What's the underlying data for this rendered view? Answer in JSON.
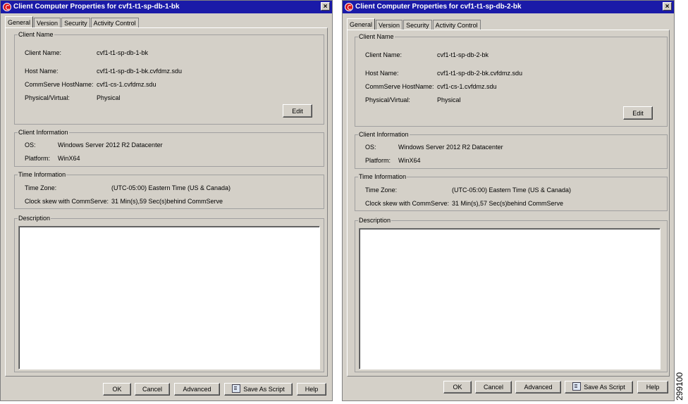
{
  "dialogs": [
    {
      "title": "Client Computer Properties for cvf1-t1-sp-db-1-bk",
      "close_label": "×",
      "tabs": [
        "General",
        "Version",
        "Security",
        "Activity Control"
      ],
      "client_name_group": {
        "legend": "Client Name",
        "client_name_label": "Client Name:",
        "client_name": "cvf1-t1-sp-db-1-bk",
        "host_name_label": "Host Name:",
        "host_name": "cvf1-t1-sp-db-1-bk.cvfdmz.sdu",
        "commserve_label": "CommServe HostName:",
        "commserve": "cvf1-cs-1.cvfdmz.sdu",
        "physvirt_label": "Physical/Virtual:",
        "physvirt": "Physical",
        "edit_label": "Edit"
      },
      "client_info_group": {
        "legend": "Client Information",
        "os_label": "OS:",
        "os": "Windows Server 2012 R2 Datacenter",
        "platform_label": "Platform:",
        "platform": "WinX64"
      },
      "time_group": {
        "legend": "Time Information",
        "tz_label": "Time Zone:",
        "tz": "(UTC-05:00) Eastern Time (US & Canada)",
        "skew_label": "Clock skew with CommServe:",
        "skew": "31 Min(s),59 Sec(s)behind CommServe"
      },
      "description_group": {
        "legend": "Description",
        "value": ""
      },
      "buttons": {
        "ok": "OK",
        "cancel": "Cancel",
        "advanced": "Advanced",
        "save_script": "Save As Script",
        "help": "Help"
      }
    },
    {
      "title": "Client Computer Properties for cvf1-t1-sp-db-2-bk",
      "close_label": "×",
      "tabs": [
        "General",
        "Version",
        "Security",
        "Activity Control"
      ],
      "client_name_group": {
        "legend": "Client Name",
        "client_name_label": "Client Name:",
        "client_name": "cvf1-t1-sp-db-2-bk",
        "host_name_label": "Host Name:",
        "host_name": "cvf1-t1-sp-db-2-bk.cvfdmz.sdu",
        "commserve_label": "CommServe HostName:",
        "commserve": "cvf1-cs-1.cvfdmz.sdu",
        "physvirt_label": "Physical/Virtual:",
        "physvirt": "Physical",
        "edit_label": "Edit"
      },
      "client_info_group": {
        "legend": "Client Information",
        "os_label": "OS:",
        "os": "Windows Server 2012 R2 Datacenter",
        "platform_label": "Platform:",
        "platform": "WinX64"
      },
      "time_group": {
        "legend": "Time Information",
        "tz_label": "Time Zone:",
        "tz": "(UTC-05:00) Eastern Time (US & Canada)",
        "skew_label": "Clock skew with CommServe:",
        "skew": "31 Min(s),57 Sec(s)behind CommServe"
      },
      "description_group": {
        "legend": "Description",
        "value": ""
      },
      "buttons": {
        "ok": "OK",
        "cancel": "Cancel",
        "advanced": "Advanced",
        "save_script": "Save As Script",
        "help": "Help"
      }
    }
  ],
  "figure_id": "299100",
  "colors": {
    "titlebar": "#1a1aa8",
    "dialog_bg": "#d4d0c8",
    "app_icon": "#d8141b"
  },
  "icons": {
    "app": "commvault-logo-icon",
    "save_script": "script-icon",
    "close": "close-icon"
  }
}
